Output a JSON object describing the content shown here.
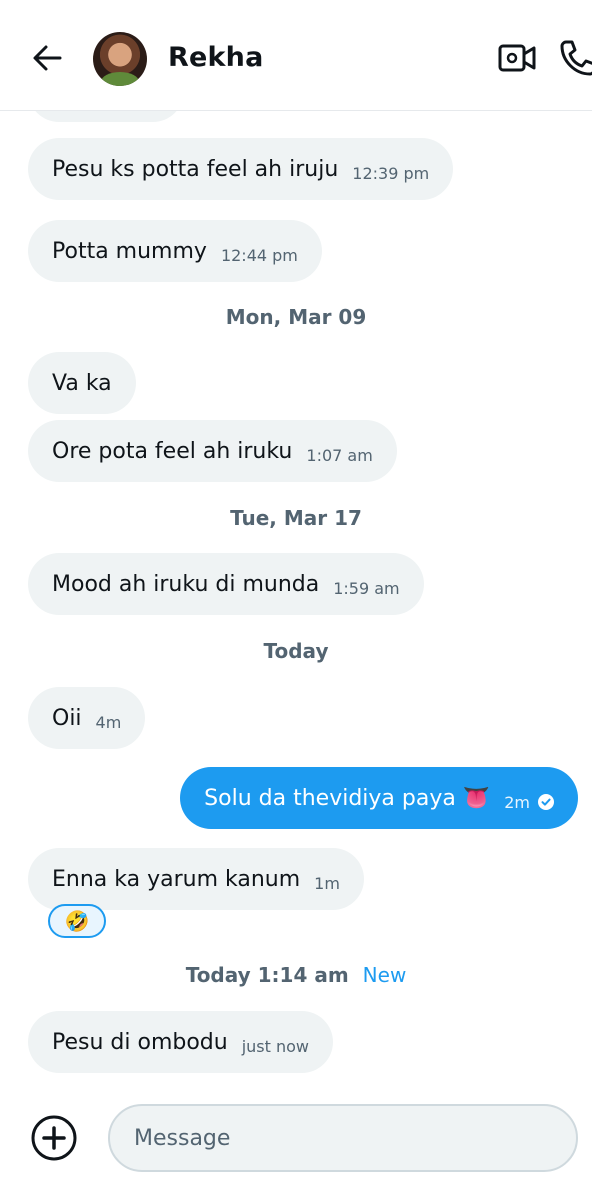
{
  "header": {
    "title": "Rekha"
  },
  "messages": [
    {
      "text": "Pesu ks potta feel ah iruju",
      "time": "12:39 pm"
    },
    {
      "text": "Potta mummy",
      "time": "12:44 pm"
    },
    {
      "text": "Va ka",
      "time": ""
    },
    {
      "text": "Ore pota feel ah iruku",
      "time": "1:07 am"
    },
    {
      "text": "Mood ah iruku di munda",
      "time": "1:59 am"
    },
    {
      "text": "Oii",
      "time": "4m"
    },
    {
      "text": "Solu da thevidiya paya 👅",
      "time": "2m"
    },
    {
      "text": "Enna ka yarum kanum",
      "time": "1m"
    },
    {
      "text": "Pesu di ombodu",
      "time": "just now"
    }
  ],
  "separators": {
    "mon": "Mon, Mar 09",
    "tue": "Tue, Mar 17",
    "today": "Today",
    "today_time": "Today 1:14 am",
    "new_label": "New"
  },
  "reaction": {
    "emoji": "🤣"
  },
  "composer": {
    "placeholder": "Message"
  },
  "colors": {
    "accent": "#1d9bf0",
    "incoming_bubble": "#eff3f4",
    "muted_text": "#536471"
  }
}
